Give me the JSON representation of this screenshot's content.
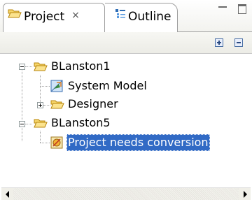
{
  "tabs": [
    {
      "label": "Project",
      "active": true,
      "icon": "folder-open-icon",
      "close": "×"
    },
    {
      "label": "Outline",
      "active": false,
      "icon": "outline-icon"
    }
  ],
  "view_controls": {
    "minimize_icon": "minimize-icon",
    "maximize_icon": "maximize-icon"
  },
  "toolbar": {
    "expand_all_icon": "expand-all-icon",
    "collapse_all_icon": "collapse-all-icon"
  },
  "tree": {
    "items": [
      {
        "label": "BLanston1",
        "icon": "folder-open-icon",
        "expanded": true
      },
      {
        "label": "System Model",
        "icon": "system-model-icon"
      },
      {
        "label": "Designer",
        "icon": "folder-open-icon",
        "expanded": false
      },
      {
        "label": "BLanston5",
        "icon": "folder-open-icon",
        "expanded": true
      },
      {
        "label": "Project needs conversion",
        "icon": "warning-conversion-icon",
        "selected": true
      }
    ]
  },
  "colors": {
    "selection": "#316ac5",
    "folder": "#f2c94c",
    "tab_border": "#9e9e9e"
  }
}
